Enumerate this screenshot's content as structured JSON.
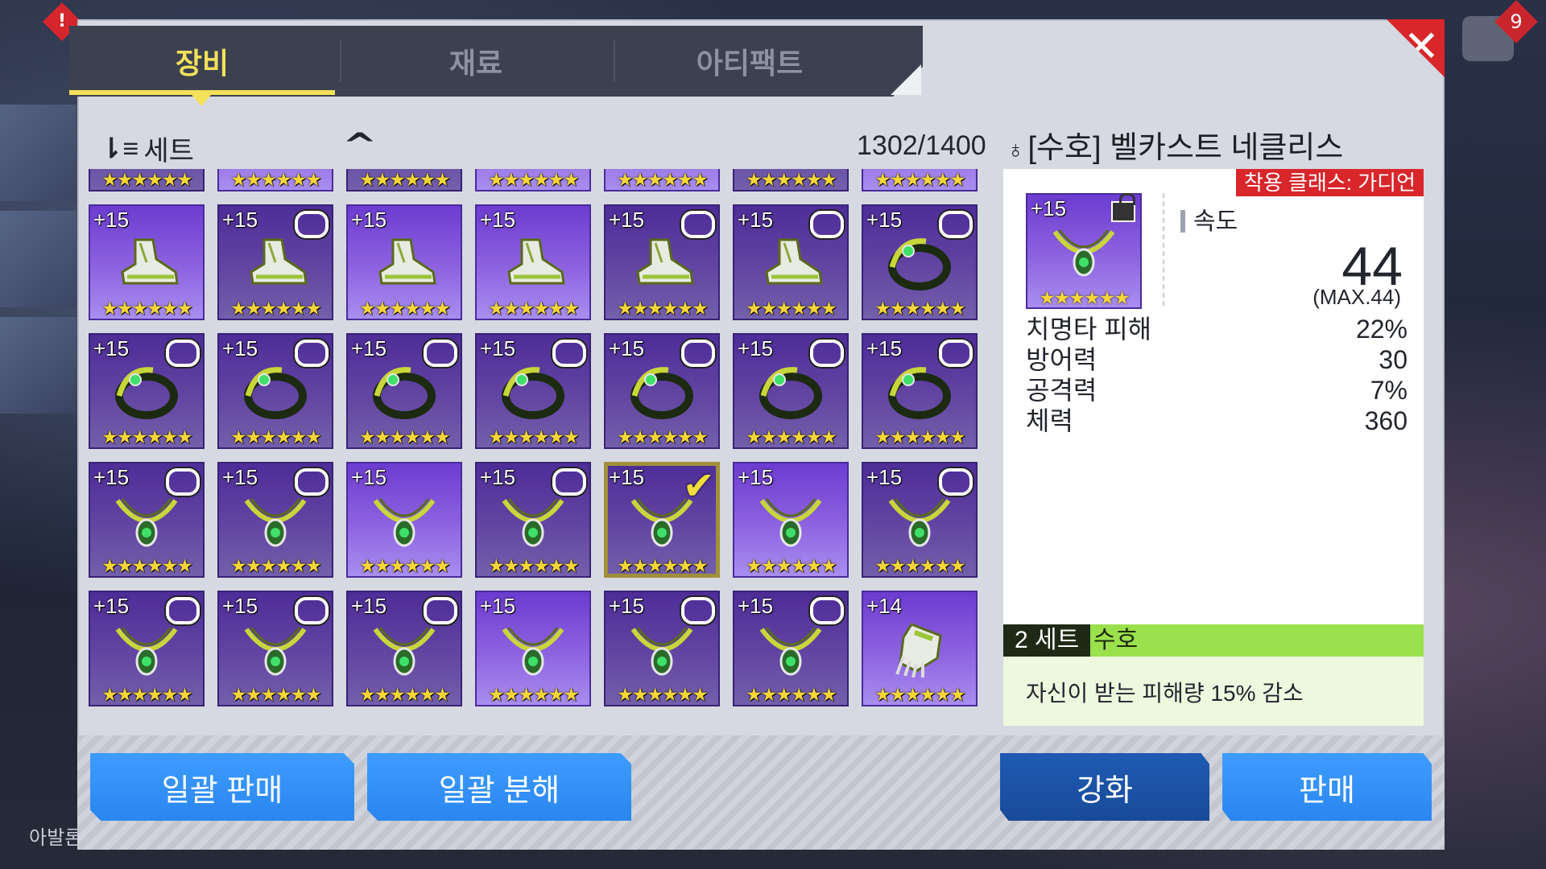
{
  "tabs": [
    {
      "label": "장비",
      "active": true
    },
    {
      "label": "재료",
      "active": false
    },
    {
      "label": "아티팩트",
      "active": false
    }
  ],
  "close_label": "✕",
  "background": {
    "notification_badge": "!",
    "chat_badge": "9",
    "bottom_left_text": "아발론"
  },
  "list": {
    "sort_label": "세트",
    "sort_icon": "sort-icon",
    "order_icon": "chevron-up-icon",
    "count": "1302/1400",
    "items": [
      {
        "level": "",
        "stars": 6,
        "type": "partial",
        "locked": false,
        "dim": true
      },
      {
        "level": "",
        "stars": 6,
        "type": "partial",
        "locked": false,
        "dim": false
      },
      {
        "level": "",
        "stars": 6,
        "type": "partial",
        "locked": false,
        "dim": true
      },
      {
        "level": "",
        "stars": 6,
        "type": "partial",
        "locked": false,
        "dim": false
      },
      {
        "level": "",
        "stars": 6,
        "type": "partial",
        "locked": false,
        "dim": false
      },
      {
        "level": "",
        "stars": 6,
        "type": "partial",
        "locked": false,
        "dim": true
      },
      {
        "level": "",
        "stars": 6,
        "type": "partial",
        "locked": false,
        "dim": false
      },
      {
        "level": "+15",
        "stars": 6,
        "type": "boots",
        "locked": false,
        "dim": false
      },
      {
        "level": "+15",
        "stars": 6,
        "type": "boots",
        "locked": true,
        "dim": true
      },
      {
        "level": "+15",
        "stars": 6,
        "type": "boots",
        "locked": false,
        "dim": false
      },
      {
        "level": "+15",
        "stars": 6,
        "type": "boots",
        "locked": false,
        "dim": false
      },
      {
        "level": "+15",
        "stars": 6,
        "type": "boots",
        "locked": true,
        "dim": true
      },
      {
        "level": "+15",
        "stars": 6,
        "type": "boots",
        "locked": true,
        "dim": true
      },
      {
        "level": "+15",
        "stars": 6,
        "type": "ring",
        "locked": true,
        "dim": true
      },
      {
        "level": "+15",
        "stars": 6,
        "type": "ring",
        "locked": true,
        "dim": true
      },
      {
        "level": "+15",
        "stars": 6,
        "type": "ring",
        "locked": true,
        "dim": true
      },
      {
        "level": "+15",
        "stars": 6,
        "type": "ring",
        "locked": true,
        "dim": true
      },
      {
        "level": "+15",
        "stars": 6,
        "type": "ring",
        "locked": true,
        "dim": true
      },
      {
        "level": "+15",
        "stars": 6,
        "type": "ring",
        "locked": true,
        "dim": true
      },
      {
        "level": "+15",
        "stars": 6,
        "type": "ring",
        "locked": true,
        "dim": true
      },
      {
        "level": "+15",
        "stars": 6,
        "type": "ring",
        "locked": true,
        "dim": true
      },
      {
        "level": "+15",
        "stars": 6,
        "type": "necklace",
        "locked": true,
        "dim": true
      },
      {
        "level": "+15",
        "stars": 6,
        "type": "necklace",
        "locked": true,
        "dim": true
      },
      {
        "level": "+15",
        "stars": 6,
        "type": "necklace",
        "locked": false,
        "dim": false
      },
      {
        "level": "+15",
        "stars": 6,
        "type": "necklace",
        "locked": true,
        "dim": true
      },
      {
        "level": "+15",
        "stars": 6,
        "type": "necklace",
        "locked": false,
        "dim": true,
        "selected": true
      },
      {
        "level": "+15",
        "stars": 6,
        "type": "necklace",
        "locked": false,
        "dim": false
      },
      {
        "level": "+15",
        "stars": 6,
        "type": "necklace",
        "locked": true,
        "dim": true
      },
      {
        "level": "+15",
        "stars": 6,
        "type": "necklace",
        "locked": true,
        "dim": true
      },
      {
        "level": "+15",
        "stars": 6,
        "type": "necklace",
        "locked": true,
        "dim": true
      },
      {
        "level": "+15",
        "stars": 6,
        "type": "necklace",
        "locked": true,
        "dim": true
      },
      {
        "level": "+15",
        "stars": 6,
        "type": "necklace",
        "locked": false,
        "dim": false
      },
      {
        "level": "+15",
        "stars": 6,
        "type": "necklace",
        "locked": true,
        "dim": true
      },
      {
        "level": "+15",
        "stars": 6,
        "type": "necklace",
        "locked": true,
        "dim": true
      },
      {
        "level": "+14",
        "stars": 6,
        "type": "gauntlet",
        "locked": false,
        "dim": false
      }
    ]
  },
  "detail": {
    "title_icon": "necklace-icon",
    "title": "[수호] 벨카스트 네클리스",
    "class_tag": "착용 클래스: 가디언",
    "thumb_level": "+15",
    "thumb_stars": 6,
    "main_stat": {
      "label": "속도",
      "value": "44",
      "max": "(MAX.44)"
    },
    "substats": [
      {
        "label": "치명타 피해",
        "value": "22%"
      },
      {
        "label": "방어력",
        "value": "30"
      },
      {
        "label": "공격력",
        "value": "7%"
      },
      {
        "label": "체력",
        "value": "360"
      }
    ],
    "set": {
      "count": "2 세트",
      "name": "수호",
      "description": "자신이 받는 피해량 15% 감소"
    }
  },
  "actions": {
    "bulk_sell": "일괄 판매",
    "bulk_dismantle": "일괄 분해",
    "enhance": "강화",
    "sell": "판매"
  },
  "colors": {
    "accent_yellow": "#f3e15a",
    "close_red": "#d9262b",
    "item_purple": "#7a4ad8",
    "set_green": "#9be04d",
    "button_blue": "#2a86f0",
    "button_dark_blue": "#1f5bb3"
  }
}
